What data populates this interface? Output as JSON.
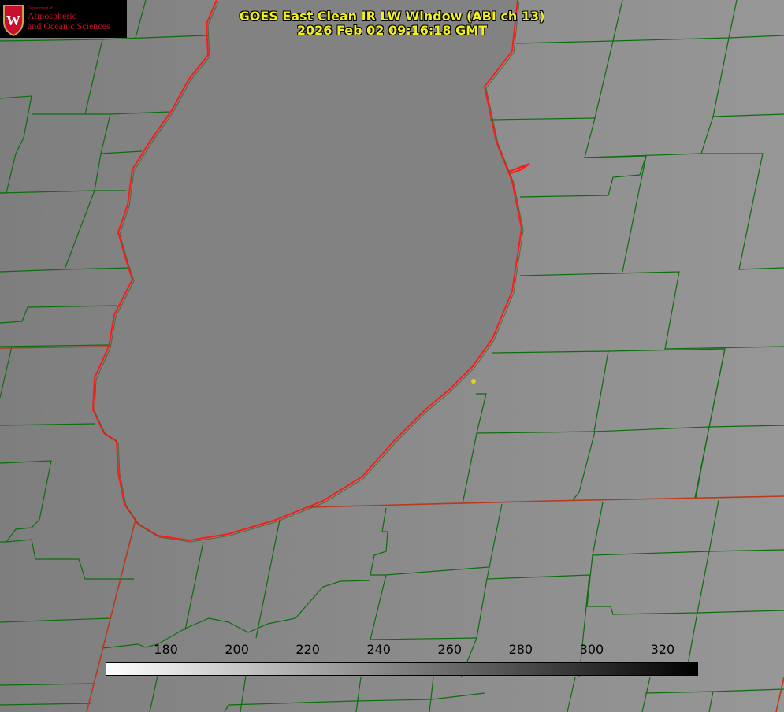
{
  "logo": {
    "dept": "Department of",
    "line1": "Atmospheric",
    "line2": "and Oceanic Sciences"
  },
  "title": {
    "line1": "GOES East Clean IR LW Window (ABI ch 13)",
    "line2": "2026 Feb 02 09:16:18 GMT"
  },
  "colorbar": {
    "ticks": [
      "180",
      "200",
      "220",
      "240",
      "260",
      "280",
      "300",
      "320"
    ],
    "min": 163,
    "max": 330,
    "ramp": "white-to-black"
  },
  "colors": {
    "county_lines": "#0d6e0d",
    "shoreline": "#ff1a1a",
    "title_text": "#f2ef1e",
    "background_gray": "#8a8a8a"
  }
}
